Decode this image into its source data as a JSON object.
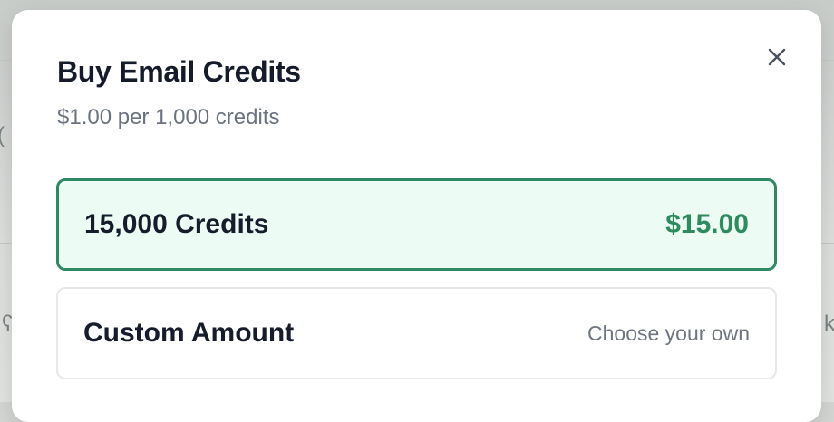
{
  "modal": {
    "title": "Buy Email Credits",
    "subtitle": "$1.00 per 1,000 credits",
    "close_icon": "close-icon"
  },
  "options": [
    {
      "label": "15,000 Credits",
      "price": "$15.00",
      "selected": true
    },
    {
      "label": "Custom Amount",
      "hint": "Choose your own",
      "selected": false
    }
  ],
  "colors": {
    "accent": "#2f8a5e",
    "selected_background": "#ecfcf4",
    "title_text": "#151b2a",
    "muted_text": "#6b7381"
  }
}
